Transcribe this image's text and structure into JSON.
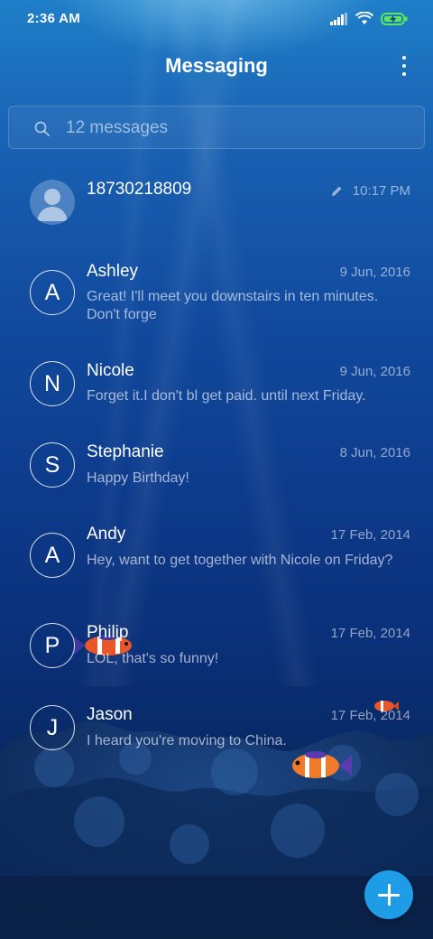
{
  "status_bar": {
    "time": "2:36 AM"
  },
  "app_bar": {
    "title": "Messaging",
    "more_icon": "more-vert-icon"
  },
  "search": {
    "placeholder": "12 messages",
    "icon": "search-icon"
  },
  "conversations": [
    {
      "avatar": "",
      "avatar_icon": "person-icon",
      "name": "18730218809",
      "date": "10:17 PM",
      "draft_icon": "pencil-icon",
      "snippet": ""
    },
    {
      "avatar": "A",
      "name": "Ashley",
      "date": "9 Jun, 2016",
      "snippet": "Great! I'll meet you downstairs in ten minutes. Don't forge"
    },
    {
      "avatar": "N",
      "name": "Nicole",
      "date": "9 Jun, 2016",
      "snippet": "Forget it.I don't bl get paid. until next Friday."
    },
    {
      "avatar": "S",
      "name": "Stephanie",
      "date": "8 Jun, 2016",
      "snippet": "Happy Birthday!"
    },
    {
      "avatar": "A",
      "name": "Andy",
      "date": "17 Feb, 2014",
      "snippet": "Hey, want to get together with Nicole on Friday?"
    },
    {
      "avatar": "P",
      "name": "Philip",
      "date": "17 Feb, 2014",
      "snippet": "LOL, that's so funny!"
    },
    {
      "avatar": "J",
      "name": "Jason",
      "date": "17 Feb, 2014",
      "snippet": "I heard you're moving to China."
    }
  ],
  "fab": {
    "icon": "plus-icon"
  },
  "colors": {
    "accent": "#1e9de6",
    "background_top": "#1f7fc8",
    "background_bottom": "#081f4a",
    "battery": "#5ce65c"
  }
}
